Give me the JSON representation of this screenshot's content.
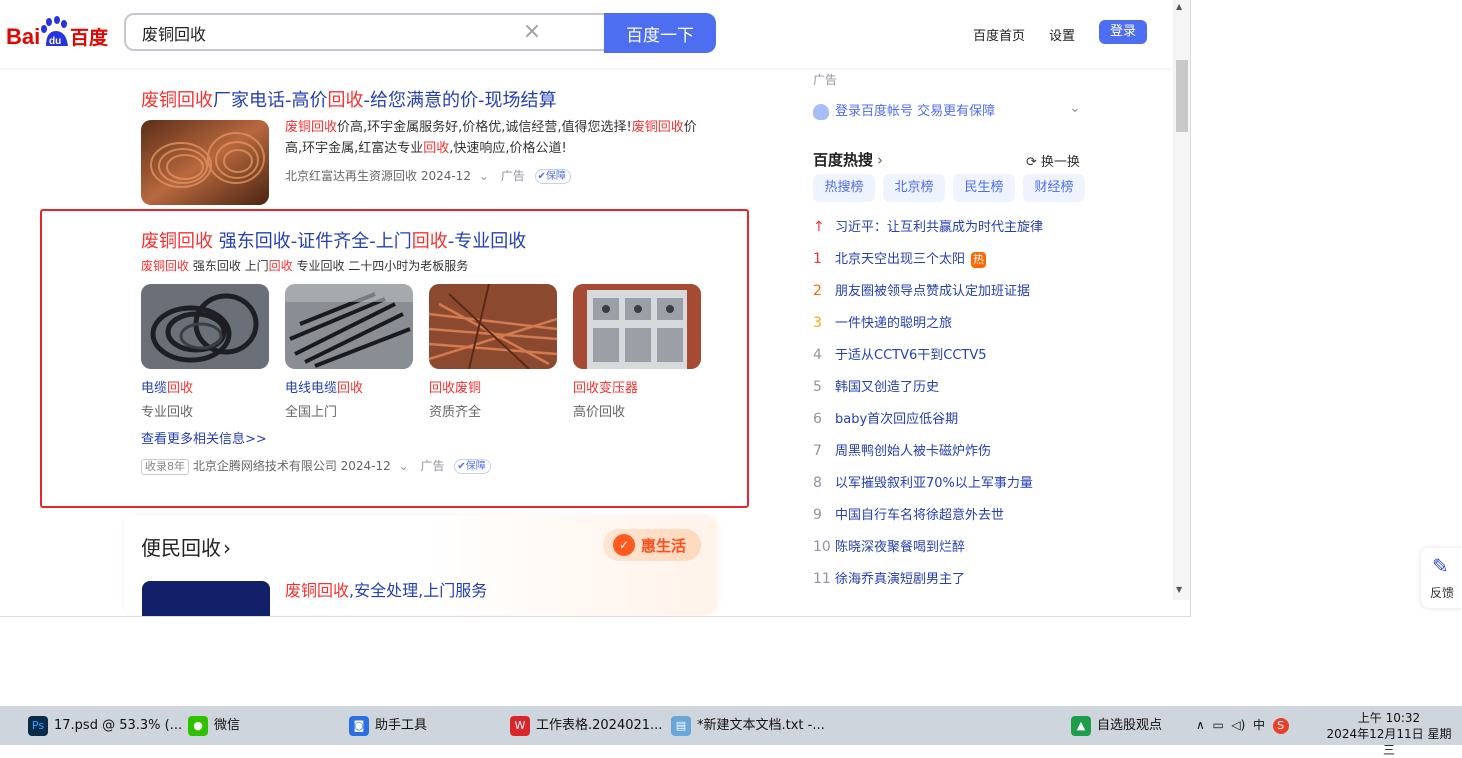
{
  "search": {
    "query": "废铜回收",
    "button": "百度一下"
  },
  "header_links": {
    "home": "百度首页",
    "settings": "设置",
    "login": "登录"
  },
  "logo": {
    "bai": "Bai",
    "du": "du",
    "cn": "百度"
  },
  "result1": {
    "title_parts": [
      "废铜回收",
      "厂家电话-高价",
      "回收",
      "-给您满意的价-现场结算"
    ],
    "desc_line1": [
      "废铜回收",
      "价高,环宇金属服务好,价格优,诚信经营,值得您选择!",
      "废铜回收",
      "价"
    ],
    "desc_line2": [
      "高,环宇金属,红富达专业",
      "回收",
      ",快速响应,价格公道!"
    ],
    "source": "北京红富达再生资源回收 2024-12",
    "ad": "广告",
    "badge": "保障"
  },
  "result2": {
    "title_parts": [
      "废铜回收",
      " 强东回收-证件齐全-上门",
      "回收",
      "-专业回收"
    ],
    "subtitle_parts": [
      "废铜回收",
      " 强东回收 上门",
      "回收",
      " 专业回收 二十四小时为老板服务"
    ],
    "items": [
      {
        "title_a": "电缆",
        "title_b": "回收",
        "title_order": "ab",
        "sub": "专业回收"
      },
      {
        "title_a": "电线电缆",
        "title_b": "回收",
        "title_order": "ab",
        "sub": "全国上门"
      },
      {
        "title_a": "回收",
        "title_b": "废铜",
        "title_order": "hl-first",
        "sub": "资质齐全"
      },
      {
        "title_a": "回收",
        "title_b": "变压器",
        "title_order": "hl-first",
        "sub": "高价回收"
      }
    ],
    "see_more": "查看更多相关信息>>",
    "tag": "收录8年",
    "source": "北京企腾网络技术有限公司 2024-12",
    "ad": "广告",
    "badge": "保障"
  },
  "bianmin": {
    "title": "便民回收",
    "badge": "惠生活",
    "item_title_parts": [
      "废铜回收",
      ",安全处理,上门服务"
    ]
  },
  "sidebar": {
    "ad_label": "广告",
    "login_prompt": "登录百度帐号 交易更有保障",
    "hot_title": "百度热搜",
    "refresh": "换一换",
    "tabs": [
      "热搜榜",
      "北京榜",
      "民生榜",
      "财经榜"
    ],
    "items": [
      {
        "rank": "↑",
        "text": "习近平：让互利共赢成为时代主旋律",
        "tag": ""
      },
      {
        "rank": "1",
        "text": "北京天空出现三个太阳",
        "tag": "热"
      },
      {
        "rank": "2",
        "text": "朋友圈被领导点赞成认定加班证据",
        "tag": ""
      },
      {
        "rank": "3",
        "text": "一件快递的聪明之旅",
        "tag": ""
      },
      {
        "rank": "4",
        "text": "于适从CCTV6干到CCTV5",
        "tag": ""
      },
      {
        "rank": "5",
        "text": "韩国又创造了历史",
        "tag": ""
      },
      {
        "rank": "6",
        "text": "baby首次回应低谷期",
        "tag": ""
      },
      {
        "rank": "7",
        "text": "周黑鸭创始人被卡磁炉炸伤",
        "tag": ""
      },
      {
        "rank": "8",
        "text": "以军摧毁叙利亚70%以上军事力量",
        "tag": ""
      },
      {
        "rank": "9",
        "text": "中国自行车名将徐超意外去世",
        "tag": ""
      },
      {
        "rank": "10",
        "text": "陈晓深夜聚餐喝到烂醉",
        "tag": ""
      },
      {
        "rank": "11",
        "text": "徐海乔真演短剧男主了",
        "tag": ""
      }
    ],
    "rank_colors": {
      "up": "#f73131",
      "r1": "#f73131",
      "r2": "#ff6600",
      "r3": "#faa90e",
      "other": "#9195a3"
    }
  },
  "feedback": {
    "label": "反馈"
  },
  "taskbar": {
    "ps": "17.psd @ 53.3% (...",
    "wechat": "微信",
    "helper": "助手工具",
    "wps": "工作表格.2024021...",
    "notepad": "*新建文本文档.txt -...",
    "stock": "自选股观点",
    "ime": "中",
    "time": "上午 10:32",
    "date": "2024年12月11日 星期三"
  },
  "colors": {
    "accent": "#4e6ef2",
    "highlight": "#f73131",
    "link": "#2440b3",
    "red_box": "#e8262a"
  }
}
